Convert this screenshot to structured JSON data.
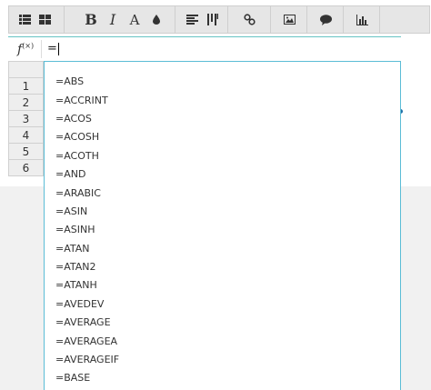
{
  "toolbar": {
    "groups": [
      {
        "buttons": [
          "list-icon",
          "grid-icon"
        ]
      },
      {
        "buttons": [
          "bold",
          "italic",
          "font-color",
          "fill-color"
        ]
      },
      {
        "buttons": [
          "align-icon",
          "borders-icon"
        ]
      },
      {
        "buttons": [
          "link-icon"
        ]
      },
      {
        "buttons": [
          "image-icon"
        ]
      },
      {
        "buttons": [
          "comment-icon"
        ]
      },
      {
        "buttons": [
          "chart-icon"
        ]
      }
    ],
    "bold_label": "B",
    "italic_label": "I",
    "font_color_label": "A"
  },
  "formula_bar": {
    "fx_label": "f",
    "fx_sub": "(×)",
    "value": "="
  },
  "grid": {
    "row_numbers": [
      "1",
      "2",
      "3",
      "4",
      "5",
      "6"
    ]
  },
  "autocomplete": {
    "items": [
      "=ABS",
      "=ACCRINT",
      "=ACOS",
      "=ACOSH",
      "=ACOTH",
      "=AND",
      "=ARABIC",
      "=ASIN",
      "=ASINH",
      "=ATAN",
      "=ATAN2",
      "=ATANH",
      "=AVEDEV",
      "=AVERAGE",
      "=AVERAGEA",
      "=AVERAGEIF",
      "=BASE"
    ]
  },
  "colors": {
    "accent_border": "#5bbcd6",
    "toolbar_bg": "#e6e6e6",
    "header_bg": "#eeeeee"
  }
}
